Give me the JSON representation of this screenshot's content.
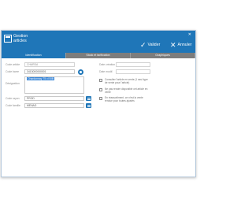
{
  "window": {
    "title_line1": "Gestion",
    "title_line2": "articles",
    "close_glyph": "✕",
    "valider_label": "Valider",
    "annuler_label": "Annuler",
    "valider_icon": "check-icon",
    "annuler_icon": "close-icon"
  },
  "tabs": [
    {
      "label": "Identification",
      "active": true
    },
    {
      "label": "Stock et tarification",
      "active": false
    },
    {
      "label": "Graphiques",
      "active": false
    }
  ],
  "form": {
    "code_article_label": "Code article",
    "code_article_value": "CHARDA",
    "code_barre_label": "Code barre",
    "code_barre_value": "3413000000001",
    "designation_label": "Désignation",
    "designation_value": "Chardonnay 75 cl BIB",
    "code_rayon_label": "Code rayon",
    "code_rayon_value": "PROD",
    "code_famille_label": "Code famille",
    "code_famille_value": "MENAG",
    "date_creation_label": "Date création",
    "date_creation_value": "",
    "date_modif_label": "Date modif.",
    "date_modif_value": ""
  },
  "options": [
    {
      "label": "Consulter l'article en vente (1 seul type de vente pour l'article)",
      "checked": false
    },
    {
      "label": "Ne pas rendre disponible cet article en vente",
      "checked": false
    },
    {
      "label": "En réassortiment, ce n'est la vente rendue pour toutes ajustés",
      "checked": false
    }
  ],
  "colors": {
    "accent": "#1f76b8",
    "tab_bar": "#7d7d7d",
    "selection": "#3a87d8"
  }
}
